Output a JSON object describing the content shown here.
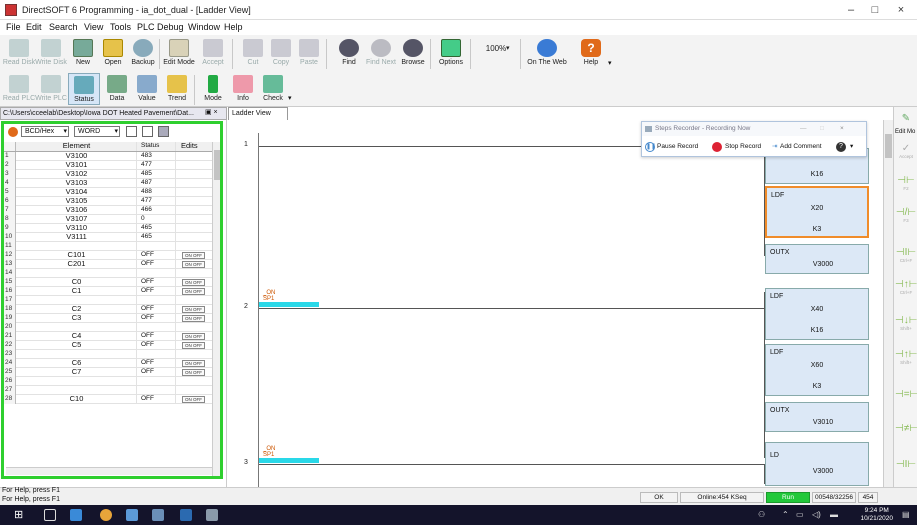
{
  "window": {
    "title": "DirectSOFT 6 Programming - ia_dot_dual - [Ladder View]",
    "minimize": "–",
    "maximize": "□",
    "close": "×"
  },
  "menu": [
    "File",
    "Edit",
    "Search",
    "View",
    "Tools",
    "PLC",
    "Debug",
    "Window",
    "Help"
  ],
  "toolbar1": [
    {
      "label": "Read Disk",
      "icon": "read-disk-icon",
      "disabled": true
    },
    {
      "label": "Write Disk",
      "icon": "write-disk-icon",
      "disabled": true
    },
    {
      "label": "New",
      "icon": "new-icon",
      "disabled": false
    },
    {
      "label": "Open",
      "icon": "open-icon",
      "disabled": false
    },
    {
      "label": "Backup",
      "icon": "backup-icon",
      "disabled": false
    },
    {
      "label": "Edit Mode",
      "icon": "edit-mode-icon",
      "disabled": false
    },
    {
      "label": "Accept",
      "icon": "accept-icon",
      "disabled": true
    },
    {
      "label": "Cut",
      "icon": "cut-icon",
      "disabled": true
    },
    {
      "label": "Copy",
      "icon": "copy-icon",
      "disabled": true
    },
    {
      "label": "Paste",
      "icon": "paste-icon",
      "disabled": true
    },
    {
      "label": "Find",
      "icon": "find-icon",
      "disabled": false
    },
    {
      "label": "Find Next",
      "icon": "find-next-icon",
      "disabled": true
    },
    {
      "label": "Browse",
      "icon": "browse-icon",
      "disabled": false
    },
    {
      "label": "Options",
      "icon": "options-icon",
      "disabled": false
    },
    {
      "label": "100%",
      "icon": "zoom-icon",
      "disabled": false
    },
    {
      "label": "On The Web",
      "icon": "web-icon",
      "disabled": false
    },
    {
      "label": "Help",
      "icon": "help-icon",
      "disabled": false
    }
  ],
  "toolbar2": [
    {
      "label": "Read PLC",
      "icon": "read-plc-icon",
      "disabled": true
    },
    {
      "label": "Write PLC",
      "icon": "write-plc-icon",
      "disabled": true
    },
    {
      "label": "Status",
      "icon": "status-icon",
      "disabled": false
    },
    {
      "label": "Data",
      "icon": "data-icon",
      "disabled": false
    },
    {
      "label": "Value",
      "icon": "value-icon",
      "disabled": false
    },
    {
      "label": "Trend",
      "icon": "trend-icon",
      "disabled": false
    },
    {
      "label": "Mode",
      "icon": "mode-icon",
      "disabled": false
    },
    {
      "label": "Info",
      "icon": "info-icon",
      "disabled": false
    },
    {
      "label": "Check",
      "icon": "check-icon",
      "disabled": false
    }
  ],
  "path_text": "C:\\Users\\cceelab\\Desktop\\Iowa DOT Heated Pavement\\Dat...",
  "ladder_tab": "Ladder View",
  "memory_view": {
    "format": "BCD/Hex",
    "type": "WORD",
    "headers": {
      "element": "Element",
      "status": "Status",
      "edits": "Edits"
    },
    "rows": [
      {
        "n": "1",
        "element": "V3100",
        "status": "483",
        "toggle": false
      },
      {
        "n": "2",
        "element": "V3101",
        "status": "477",
        "toggle": false
      },
      {
        "n": "3",
        "element": "V3102",
        "status": "485",
        "toggle": false
      },
      {
        "n": "4",
        "element": "V3103",
        "status": "487",
        "toggle": false
      },
      {
        "n": "5",
        "element": "V3104",
        "status": "488",
        "toggle": false
      },
      {
        "n": "6",
        "element": "V3105",
        "status": "477",
        "toggle": false
      },
      {
        "n": "7",
        "element": "V3106",
        "status": "466",
        "toggle": false
      },
      {
        "n": "8",
        "element": "V3107",
        "status": "0",
        "toggle": false
      },
      {
        "n": "9",
        "element": "V3110",
        "status": "465",
        "toggle": false
      },
      {
        "n": "10",
        "element": "V3111",
        "status": "465",
        "toggle": false
      },
      {
        "n": "11",
        "element": "",
        "status": "",
        "toggle": false
      },
      {
        "n": "12",
        "element": "C101",
        "status": "OFF",
        "toggle": true
      },
      {
        "n": "13",
        "element": "C201",
        "status": "OFF",
        "toggle": true
      },
      {
        "n": "14",
        "element": "",
        "status": "",
        "toggle": false
      },
      {
        "n": "15",
        "element": "C0",
        "status": "OFF",
        "toggle": true
      },
      {
        "n": "16",
        "element": "C1",
        "status": "OFF",
        "toggle": true
      },
      {
        "n": "17",
        "element": "",
        "status": "",
        "toggle": false
      },
      {
        "n": "18",
        "element": "C2",
        "status": "OFF",
        "toggle": true
      },
      {
        "n": "19",
        "element": "C3",
        "status": "OFF",
        "toggle": true
      },
      {
        "n": "20",
        "element": "",
        "status": "",
        "toggle": false
      },
      {
        "n": "21",
        "element": "C4",
        "status": "OFF",
        "toggle": true
      },
      {
        "n": "22",
        "element": "C5",
        "status": "OFF",
        "toggle": true
      },
      {
        "n": "23",
        "element": "",
        "status": "",
        "toggle": false
      },
      {
        "n": "24",
        "element": "C6",
        "status": "OFF",
        "toggle": true
      },
      {
        "n": "25",
        "element": "C7",
        "status": "OFF",
        "toggle": true
      },
      {
        "n": "26",
        "element": "",
        "status": "",
        "toggle": false
      },
      {
        "n": "27",
        "element": "",
        "status": "",
        "toggle": false
      },
      {
        "n": "28",
        "element": "C10",
        "status": "OFF",
        "toggle": true
      }
    ],
    "toggle_on": "ON",
    "toggle_off": "OFF"
  },
  "ladder": {
    "rungs": [
      "1",
      "2",
      "3"
    ],
    "contacts": [
      {
        "rung": 2,
        "l1": "_ON",
        "l2": "SP1"
      },
      {
        "rung": 3,
        "l1": "_ON",
        "l2": "SP1"
      }
    ],
    "boxes": {
      "r1_top": {
        "arg": "K16"
      },
      "r1_ldf": {
        "op": "LDF",
        "arg1": "X20",
        "arg2": "K3"
      },
      "r1_out": {
        "op": "OUTX",
        "arg1": "V3000"
      },
      "r2_ldf1": {
        "op": "LDF",
        "arg1": "X40",
        "arg2": "K16"
      },
      "r2_ldf2": {
        "op": "LDF",
        "arg1": "X60",
        "arg2": "K3"
      },
      "r2_out": {
        "op": "OUTX",
        "arg1": "V3010"
      },
      "r3_ld": {
        "op": "LD",
        "arg1": "V3000"
      }
    }
  },
  "steps_recorder": {
    "title": "Steps Recorder - Recording Now",
    "pause": "Pause Record",
    "stop": "Stop Record",
    "comment": "Add Comment"
  },
  "edit_palette": {
    "title": "Edit Mo",
    "accept": "Accept",
    "keys": [
      "F2",
      "F3",
      "Ctrl+F",
      "Ctrl+F",
      "Shift+",
      "Shift+"
    ]
  },
  "status_bar": {
    "line1": "For Help, press F1",
    "line2": "For Help, press F1",
    "ok": "OK",
    "online": "Online:454 KSeq",
    "run": "Run",
    "memory": "00548/32256",
    "num": "454"
  },
  "taskbar": {
    "time": "9:24 PM",
    "date": "10/21/2020"
  },
  "colors": {
    "run": "#22c83a",
    "highlight": "#2fcf2f",
    "contact": "#29d8e8",
    "taskbar": "#14142b"
  }
}
